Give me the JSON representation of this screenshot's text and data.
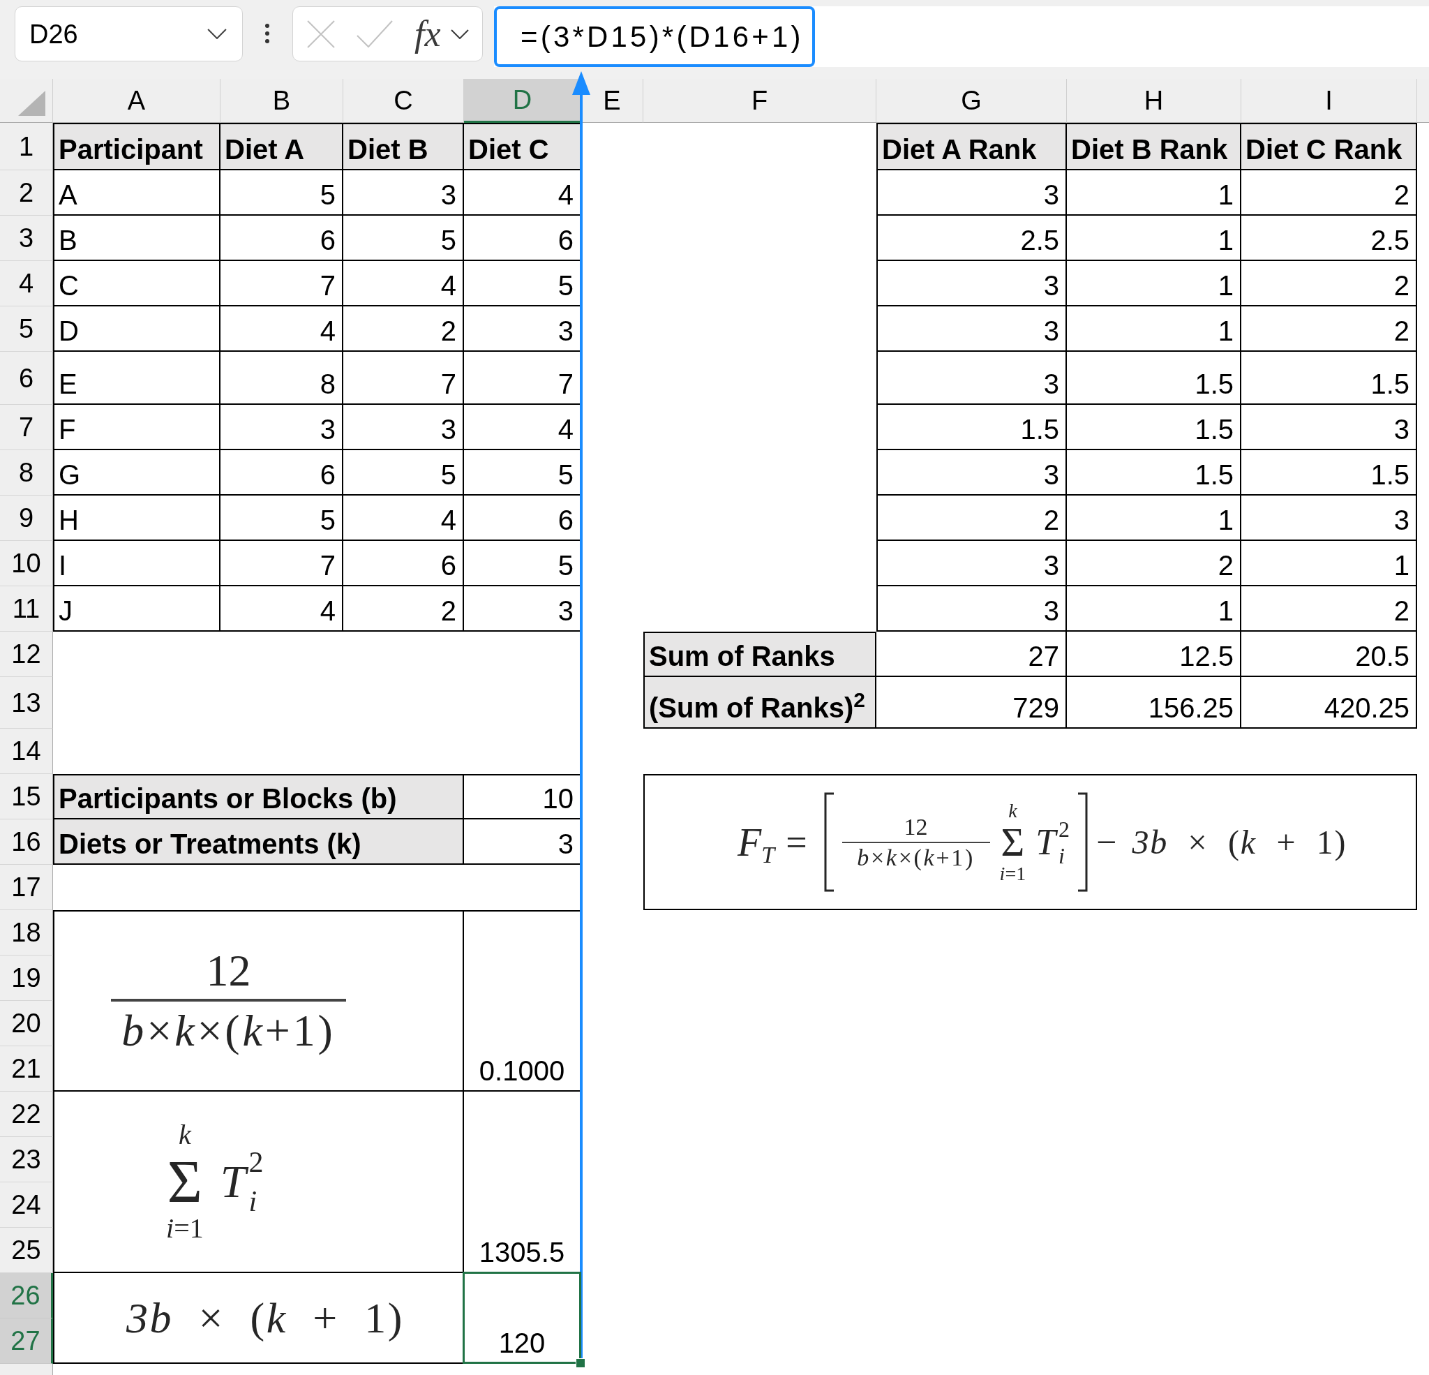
{
  "formula_bar": {
    "name_box": "D26",
    "buttons": [
      {
        "kind": "cancel",
        "disabled": true
      },
      {
        "kind": "enter",
        "disabled": true
      },
      {
        "kind": "function",
        "label": "fx",
        "disabled": false
      }
    ],
    "formula": "=(3*D15)*(D16+1)"
  },
  "columns": [
    {
      "label": "A",
      "selected": false
    },
    {
      "label": "B",
      "selected": false
    },
    {
      "label": "C",
      "selected": false
    },
    {
      "label": "D",
      "selected": true
    },
    {
      "label": "E",
      "selected": false
    },
    {
      "label": "F",
      "selected": false
    },
    {
      "label": "G",
      "selected": false
    },
    {
      "label": "H",
      "selected": false
    },
    {
      "label": "I",
      "selected": false
    }
  ],
  "rows": [
    {
      "label": "1",
      "selected": false
    },
    {
      "label": "2",
      "selected": false
    },
    {
      "label": "3",
      "selected": false
    },
    {
      "label": "4",
      "selected": false
    },
    {
      "label": "5",
      "selected": false
    },
    {
      "label": "6",
      "selected": false
    },
    {
      "label": "7",
      "selected": false
    },
    {
      "label": "8",
      "selected": false
    },
    {
      "label": "9",
      "selected": false
    },
    {
      "label": "10",
      "selected": false
    },
    {
      "label": "11",
      "selected": false
    },
    {
      "label": "12",
      "selected": false
    },
    {
      "label": "13",
      "selected": false
    },
    {
      "label": "14",
      "selected": false
    },
    {
      "label": "15",
      "selected": false
    },
    {
      "label": "16",
      "selected": false
    },
    {
      "label": "17",
      "selected": false
    },
    {
      "label": "18",
      "selected": false
    },
    {
      "label": "19",
      "selected": false
    },
    {
      "label": "20",
      "selected": false
    },
    {
      "label": "21",
      "selected": false
    },
    {
      "label": "22",
      "selected": false
    },
    {
      "label": "23",
      "selected": false
    },
    {
      "label": "24",
      "selected": false
    },
    {
      "label": "25",
      "selected": false
    },
    {
      "label": "26",
      "selected": true
    },
    {
      "label": "27",
      "selected": true
    }
  ],
  "scores_table": {
    "columns": [
      "Participant",
      "Diet A",
      "Diet B",
      "Diet C"
    ],
    "rows": [
      [
        "A",
        "5",
        "3",
        "4"
      ],
      [
        "B",
        "6",
        "5",
        "6"
      ],
      [
        "C",
        "7",
        "4",
        "5"
      ],
      [
        "D",
        "4",
        "2",
        "3"
      ],
      [
        "E",
        "8",
        "7",
        "7"
      ],
      [
        "F",
        "3",
        "3",
        "4"
      ],
      [
        "G",
        "6",
        "5",
        "5"
      ],
      [
        "H",
        "5",
        "4",
        "6"
      ],
      [
        "I",
        "7",
        "6",
        "5"
      ],
      [
        "J",
        "4",
        "2",
        "3"
      ]
    ]
  },
  "ranks_table": {
    "columns": [
      "Diet A Rank",
      "Diet B Rank",
      "Diet C Rank"
    ],
    "rows": [
      [
        "3",
        "1",
        "2"
      ],
      [
        "2.5",
        "1",
        "2.5"
      ],
      [
        "3",
        "1",
        "2"
      ],
      [
        "3",
        "1",
        "2"
      ],
      [
        "3",
        "1.5",
        "1.5"
      ],
      [
        "1.5",
        "1.5",
        "3"
      ],
      [
        "3",
        "1.5",
        "1.5"
      ],
      [
        "2",
        "1",
        "3"
      ],
      [
        "3",
        "2",
        "1"
      ],
      [
        "3",
        "1",
        "2"
      ]
    ],
    "totals": [
      {
        "label": "Sum of Ranks",
        "values": [
          "27",
          "12.5",
          "20.5"
        ]
      },
      {
        "label": "(Sum of Ranks)$^{2}$",
        "values": [
          "729",
          "156.25",
          "420.25"
        ]
      }
    ]
  },
  "parameters": [
    {
      "label": "Participants or Blocks (b)",
      "value": "10"
    },
    {
      "label": "Diets or Treatments (k)",
      "value": "3"
    }
  ],
  "calculations": [
    {
      "kind": "fraction",
      "numerator": "12",
      "denominator": "*b*×*k*×(*k*+1)",
      "value": "0.1000",
      "selected": false
    },
    {
      "kind": "sum",
      "upper": "k",
      "symbol": "Σ",
      "lower": "*i*=1",
      "base": "T",
      "sup": "2",
      "sub": "i",
      "value": "1305.5",
      "selected": false
    },
    {
      "kind": "expression",
      "expression": "*3b* × (*k* + 1)",
      "value": "120",
      "selected": true
    }
  ],
  "equation": {
    "lhs": "F",
    "lhs_sub": "T",
    "equals": "=",
    "fraction": {
      "numerator": "12",
      "denominator": "*b*×*k*×(*k*+1)"
    },
    "sum": {
      "upper": "k",
      "symbol": "Σ",
      "lower": "*i*=1",
      "base": "T",
      "sup": "2",
      "sub": "i"
    },
    "minus": "−",
    "tail": "*3b* × (*k* + 1)"
  }
}
